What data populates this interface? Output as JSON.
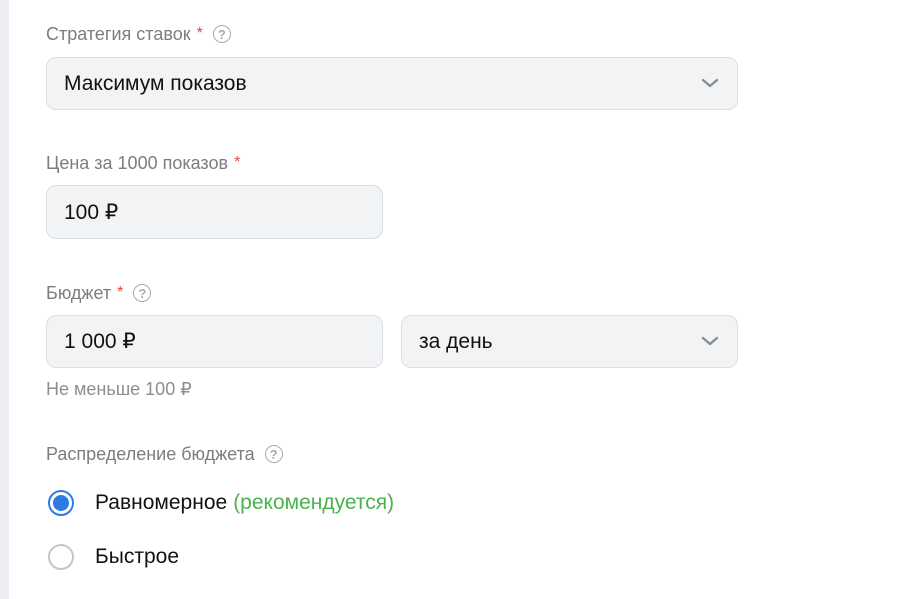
{
  "strategy": {
    "label": "Стратегия ставок",
    "required_mark": "*",
    "value": "Максимум показов"
  },
  "price": {
    "label": "Цена за 1000 показов",
    "required_mark": "*",
    "value": "100 ₽"
  },
  "budget": {
    "label": "Бюджет",
    "required_mark": "*",
    "value": "1 000 ₽",
    "period": "за день",
    "hint": "Не меньше 100 ₽"
  },
  "distribution": {
    "label": "Распределение бюджета",
    "options": [
      {
        "label": "Равномерное",
        "note": "(рекомендуется)",
        "selected": true
      },
      {
        "label": "Быстрое",
        "selected": false
      }
    ]
  },
  "help_icon": "?",
  "colors": {
    "accent": "#2c7be5",
    "required": "#e64646",
    "recommended": "#4bb34b"
  }
}
